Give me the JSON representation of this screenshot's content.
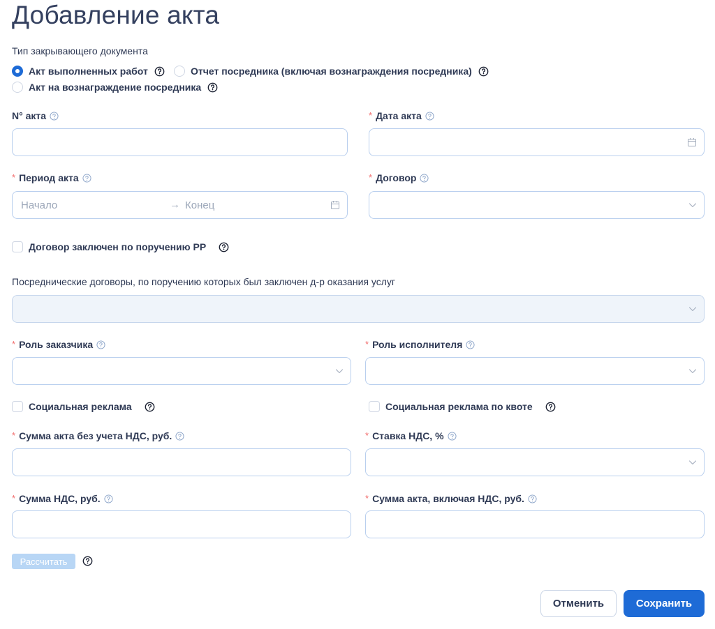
{
  "page": {
    "title": "Добавление акта"
  },
  "doc_type": {
    "label": "Тип закрывающего документа",
    "options": [
      {
        "label": "Акт выполненных работ",
        "checked": true
      },
      {
        "label": "Отчет посредника (включая вознаграждения посредника)",
        "checked": false
      },
      {
        "label": "Акт на вознаграждение посредника",
        "checked": false
      }
    ]
  },
  "fields": {
    "act_number": {
      "label": "N° акта",
      "value": ""
    },
    "act_date": {
      "label": "Дата акта",
      "required_mark": "*",
      "value": ""
    },
    "act_period": {
      "label": "Период акта",
      "required_mark": "*",
      "start_placeholder": "Начало",
      "end_placeholder": "Конец",
      "arrow": "→"
    },
    "contract": {
      "label": "Договор",
      "required_mark": "*",
      "value": ""
    },
    "contract_pp": {
      "label": "Договор заключен по поручению РР",
      "checked": false
    },
    "intermediary_contracts": {
      "label": "Посреднические договоры, по поручению которых был заключен д-р оказания услуг",
      "value": ""
    },
    "customer_role": {
      "label": "Роль заказчика",
      "required_mark": "*",
      "value": ""
    },
    "executor_role": {
      "label": "Роль исполнителя",
      "required_mark": "*",
      "value": ""
    },
    "social_ad": {
      "label": "Социальная реклама",
      "checked": false
    },
    "social_ad_quota": {
      "label": "Социальная реклама по квоте",
      "checked": false
    },
    "sum_no_vat": {
      "label": "Сумма акта без учета НДС, руб.",
      "required_mark": "*",
      "value": ""
    },
    "vat_rate": {
      "label": "Ставка НДС, %",
      "required_mark": "*",
      "value": ""
    },
    "vat_sum": {
      "label": "Сумма НДС, руб.",
      "required_mark": "*",
      "value": ""
    },
    "sum_with_vat": {
      "label": "Сумма акта, включая НДС, руб.",
      "required_mark": "*",
      "value": ""
    }
  },
  "buttons": {
    "calculate": "Рассчитать",
    "cancel": "Отменить",
    "save": "Сохранить"
  },
  "colors": {
    "primary": "#1e6bd6",
    "required": "#f26d6d",
    "border": "#b9cfee",
    "text": "#2f3a55"
  },
  "icons": {
    "help_light": "help-circle-outline-icon",
    "help_dark": "help-circle-icon",
    "calendar": "calendar-icon",
    "chevron": "chevron-down-icon"
  }
}
